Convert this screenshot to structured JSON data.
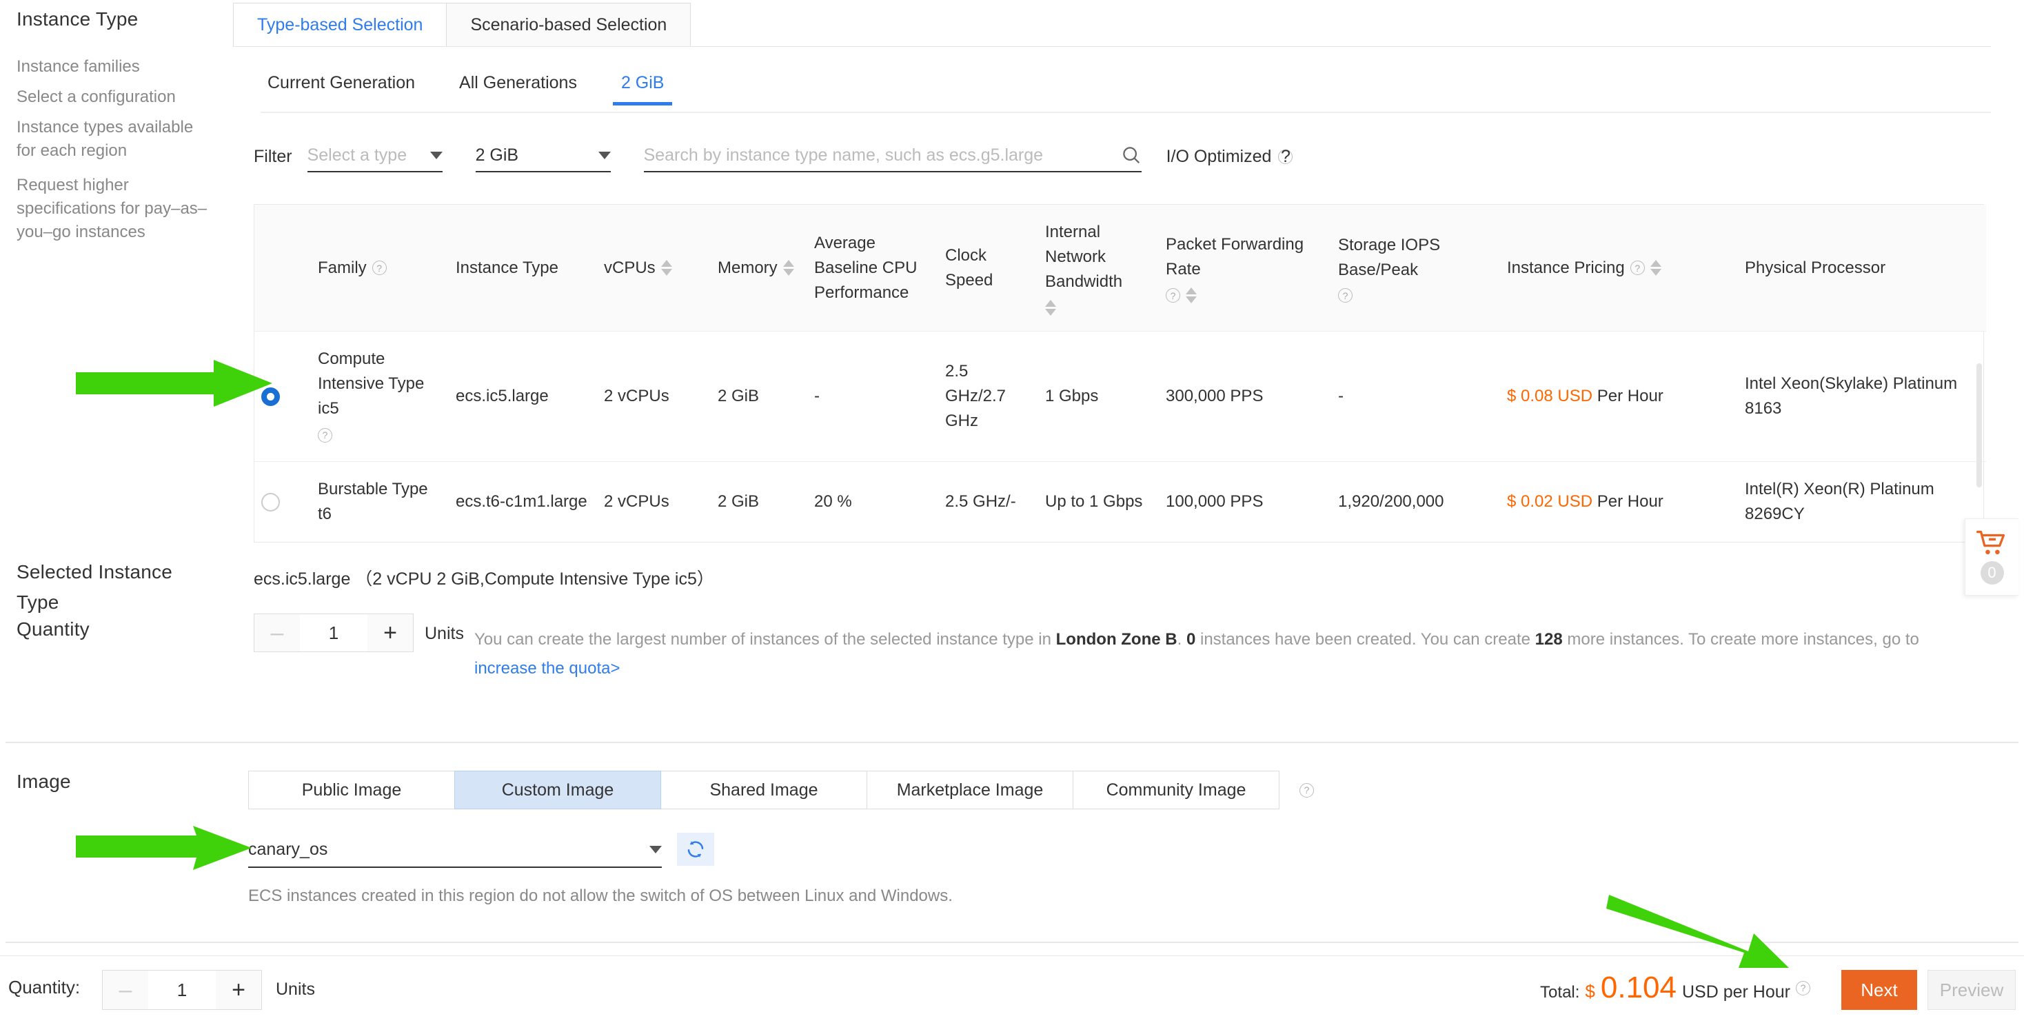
{
  "sidebar": {
    "title": "Instance Type",
    "links": [
      "Instance families",
      "Select a configuration",
      "Instance types available for each region",
      "Request higher specifications for pay–as–you–go instances"
    ]
  },
  "tabs": [
    {
      "label": "Type-based Selection",
      "active": true
    },
    {
      "label": "Scenario-based Selection",
      "active": false
    }
  ],
  "subtabs": [
    {
      "label": "Current Generation",
      "active": false
    },
    {
      "label": "All Generations",
      "active": false
    },
    {
      "label": "2 GiB",
      "active": true
    }
  ],
  "filter": {
    "label": "Filter",
    "type_select": {
      "value": "Select a type",
      "is_placeholder": true
    },
    "memory_select": {
      "value": "2 GiB",
      "is_placeholder": false
    },
    "search_placeholder": "Search by instance type name, such as ecs.g5.large",
    "search_value": "",
    "io_optimized": "I/O Optimized"
  },
  "table": {
    "columns": [
      {
        "label": "",
        "sortable": false,
        "help": false
      },
      {
        "label": "Family",
        "sortable": false,
        "help": true
      },
      {
        "label": "Instance Type",
        "sortable": false,
        "help": false
      },
      {
        "label": "vCPUs",
        "sortable": true,
        "help": false
      },
      {
        "label": "Memory",
        "sortable": true,
        "help": false
      },
      {
        "label": "Average Baseline CPU Performance",
        "sortable": false,
        "help": false
      },
      {
        "label": "Clock Speed",
        "sortable": false,
        "help": false
      },
      {
        "label": "Internal Network Bandwidth",
        "sortable": true,
        "help": false
      },
      {
        "label": "Packet Forwarding Rate",
        "sortable": true,
        "help": true
      },
      {
        "label": "Storage IOPS Base/Peak",
        "sortable": false,
        "help": true
      },
      {
        "label": "Instance Pricing",
        "sortable": true,
        "help": true
      },
      {
        "label": "Physical Processor",
        "sortable": false,
        "help": false
      }
    ],
    "rows": [
      {
        "selected": true,
        "family": "Compute Intensive Type ic5",
        "family_help": true,
        "instance_type": "ecs.ic5.large",
        "vcpus": "2 vCPUs",
        "memory": "2 GiB",
        "avg_baseline_cpu": "-",
        "clock_speed": "2.5 GHz/2.7 GHz",
        "internal_bandwidth": "1 Gbps",
        "packet_rate": "300,000 PPS",
        "storage_iops": "-",
        "price_amount": "$ 0.08 USD",
        "price_suffix": "Per Hour",
        "processor": "Intel Xeon(Skylake) Platinum 8163"
      },
      {
        "selected": false,
        "family": "Burstable Type t6",
        "family_help": false,
        "instance_type": "ecs.t6-c1m1.large",
        "vcpus": "2 vCPUs",
        "memory": "2 GiB",
        "avg_baseline_cpu": "20 %",
        "clock_speed": "2.5 GHz/-",
        "internal_bandwidth": "Up to 1 Gbps",
        "packet_rate": "100,000 PPS",
        "storage_iops": "1,920/200,000",
        "price_amount": "$ 0.02 USD",
        "price_suffix": "Per Hour",
        "processor": "Intel(R) Xeon(R) Platinum 8269CY"
      }
    ]
  },
  "selected_instance": {
    "label_line1": "Selected Instance",
    "label_line2": "Type",
    "value": "ecs.ic5.large （2 vCPU 2 GiB,Compute Intensive Type ic5）"
  },
  "quantity": {
    "label": "Quantity",
    "value": "1",
    "units": "Units",
    "minus": "–",
    "plus": "+",
    "hint_part1": "You can create the largest number of instances of the selected instance type in ",
    "hint_zone": "London Zone B",
    "hint_part2": ". ",
    "hint_created_count": "0",
    "hint_part3": " instances have been created. You can create ",
    "hint_remaining": "128",
    "hint_part4": " more instances. To create more instances, go to ",
    "hint_link": "increase the quota>"
  },
  "image": {
    "label": "Image",
    "tabs": [
      {
        "label": "Public Image",
        "active": false
      },
      {
        "label": "Custom Image",
        "active": true
      },
      {
        "label": "Shared Image",
        "active": false
      },
      {
        "label": "Marketplace Image",
        "active": false
      },
      {
        "label": "Community Image",
        "active": false
      }
    ],
    "selected_image": "canary_os",
    "note": "ECS instances created in this region do not allow the switch of OS between Linux and Windows."
  },
  "cart": {
    "count": "0"
  },
  "footer": {
    "quantity_label": "Quantity:",
    "quantity_value": "1",
    "units": "Units",
    "minus": "–",
    "plus": "+",
    "total_label": "Total:",
    "total_currency": "$",
    "total_amount": "0.104",
    "total_unit": "USD per Hour",
    "next_label": "Next",
    "preview_label": "Preview"
  },
  "colors": {
    "accent_blue": "#2f7ced",
    "price_orange": "#f60",
    "next_orange": "#ea6522",
    "arrow_green": "#3fd20a"
  }
}
